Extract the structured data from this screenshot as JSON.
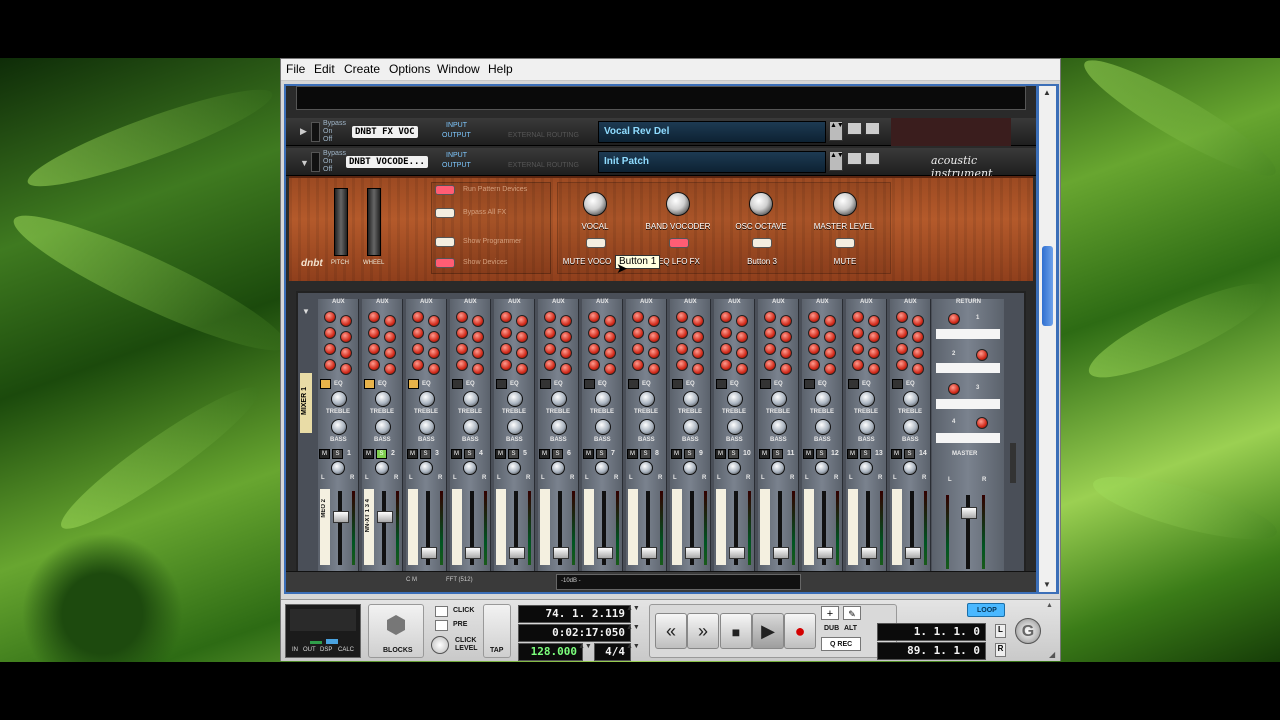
{
  "window": {
    "menu": [
      "File",
      "Edit",
      "Create",
      "Options",
      "Window",
      "Help"
    ]
  },
  "rack": {
    "device1": {
      "bypass": "Bypass",
      "on": "On",
      "off": "Off",
      "name_label": "DNBT FX VOC",
      "input": "INPUT",
      "output": "OUTPUT",
      "routing": "EXTERNAL ROUTING",
      "patch": "Vocal Rev Del"
    },
    "device2": {
      "bypass": "Bypass",
      "on": "On",
      "off": "Off",
      "name_label": "DNBT VOCODE...",
      "input": "INPUT",
      "output": "OUTPUT",
      "routing": "EXTERNAL ROUTING",
      "patch": "Init Patch",
      "brand": "acoustic instrument",
      "logo": "dnbt",
      "wheel_labels": [
        "PITCH",
        "WHEEL"
      ],
      "left_buttons": [
        "Run Pattern Devices",
        "Bypass All FX",
        "Show Programmer",
        "Show Devices"
      ],
      "knobs": [
        "VOCAL",
        "BAND VOCODER",
        "OSC OCTAVE",
        "MASTER LEVEL"
      ],
      "buttons": [
        "MUTE VOCO",
        "EQ LFO FX",
        "Button 3",
        "MUTE"
      ],
      "tooltip": "Button 1"
    },
    "mixer": {
      "side_label": "MIXER 1",
      "aux": "AUX",
      "return": "RETURN",
      "eq": "EQ",
      "treble": "TREBLE",
      "bass": "BASS",
      "master": "MASTER",
      "returns": [
        "1",
        "2",
        "3",
        "4"
      ],
      "channels": [
        "1",
        "2",
        "3",
        "4",
        "5",
        "6",
        "7",
        "8",
        "9",
        "10",
        "11",
        "12",
        "13",
        "14"
      ],
      "m": "M",
      "s": "S",
      "l": "L",
      "r": "R",
      "strip_labels": [
        "MEO 2",
        "NN-XT 1 3 4"
      ],
      "bottom_text": [
        "C M",
        "FFT (512)",
        "-10dB -"
      ]
    }
  },
  "transport": {
    "panel": [
      "IN",
      "OUT",
      "DSP",
      "CALC"
    ],
    "blocks": "BLOCKS",
    "click": "CLICK",
    "pre": "PRE",
    "click_level": "CLICK LEVEL",
    "tap": "TAP",
    "position": "74.  1.  2.119",
    "time": "0:02:17:050",
    "tempo": "128.000",
    "signature": "4/4",
    "dub": "DUB",
    "alt": "ALT",
    "qrec": "Q REC",
    "loop": "LOOP",
    "left_locator": "1.  1.  1.    0",
    "right_locator": "89.  1.  1.    0",
    "l": "L",
    "r": "R"
  }
}
